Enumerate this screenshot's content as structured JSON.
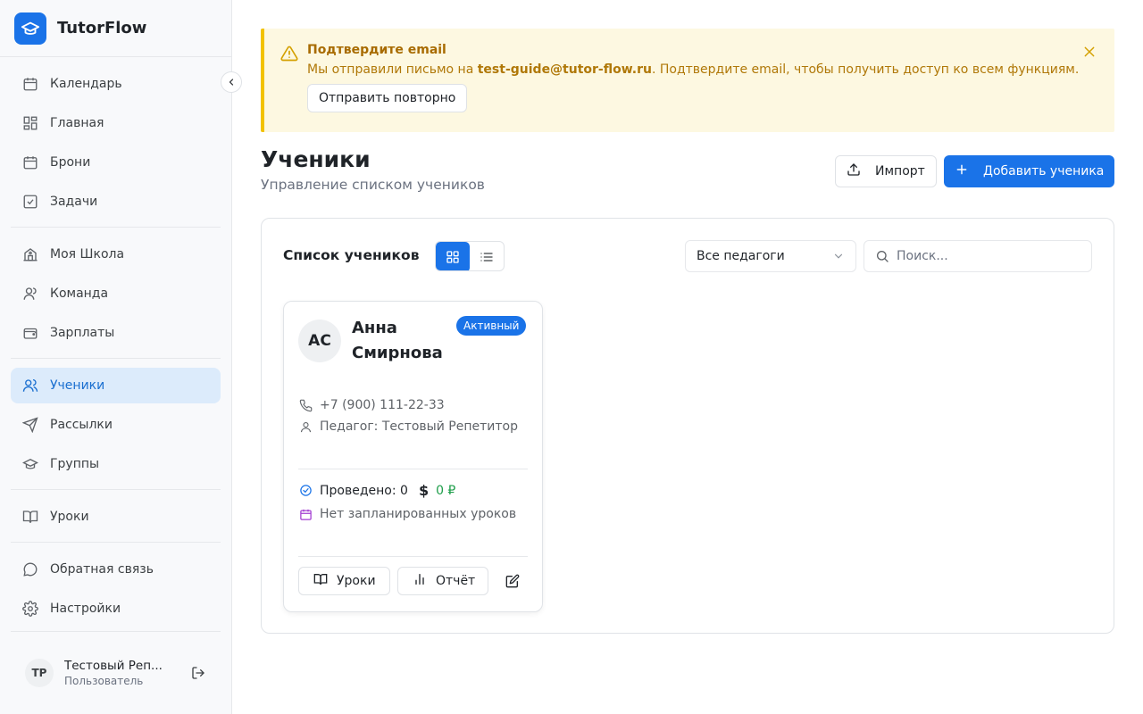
{
  "brand": {
    "name": "TutorFlow",
    "logo_icon": "graduation-cap-icon",
    "accent": "#1a73e8"
  },
  "sidebar": {
    "groups": [
      [
        {
          "label": "Календарь",
          "icon": "calendar-icon"
        },
        {
          "label": "Главная",
          "icon": "dashboard-icon"
        },
        {
          "label": "Брони",
          "icon": "calendar-icon"
        },
        {
          "label": "Задачи",
          "icon": "checkbox-icon"
        }
      ],
      [
        {
          "label": "Моя Школа",
          "icon": "school-icon"
        },
        {
          "label": "Команда",
          "icon": "team-icon"
        },
        {
          "label": "Зарплаты",
          "icon": "wallet-icon"
        }
      ],
      [
        {
          "label": "Ученики",
          "icon": "users-icon",
          "active": true
        },
        {
          "label": "Рассылки",
          "icon": "send-icon"
        },
        {
          "label": "Группы",
          "icon": "graduation-cap-icon"
        }
      ],
      [
        {
          "label": "Уроки",
          "icon": "book-icon"
        }
      ],
      [
        {
          "label": "Обратная связь",
          "icon": "message-icon"
        },
        {
          "label": "Настройки",
          "icon": "gear-icon"
        }
      ]
    ],
    "user": {
      "initials": "TP",
      "name": "Тестовый Репетитор",
      "name_display": "Тестовый Реп...",
      "role": "Пользователь"
    }
  },
  "banner": {
    "title": "Подтвердите email",
    "text_before": "Мы отправили письмо на ",
    "email": "test-guide@tutor-flow.ru",
    "text_after": ". Подтвердите email, чтобы получить доступ ко всем функциям.",
    "resend_label": "Отправить повторно",
    "colors": {
      "background": "#fdf8e1",
      "border": "#f2c200",
      "text": "#b07808"
    }
  },
  "page": {
    "title": "Ученики",
    "subtitle": "Управление списком учеников",
    "import_label": "Импорт",
    "add_label": "Добавить ученика"
  },
  "panel": {
    "title": "Список учеников",
    "view_mode": "grid",
    "teacher_filter": "Все педагоги",
    "search_placeholder": "Поиск...",
    "search_value": ""
  },
  "students": [
    {
      "initials": "АС",
      "first_name": "Анна",
      "last_name": "Смирнова",
      "status": "Активный",
      "phone": "+7 (900) 111-22-33",
      "teacher": "Педагог: Тестовый Репетитор",
      "conducted": "Проведено: 0",
      "balance": "0 ₽",
      "currency_icon": "$",
      "schedule": "Нет запланированных уроков",
      "lessons_btn": "Уроки",
      "report_btn": "Отчёт"
    }
  ]
}
